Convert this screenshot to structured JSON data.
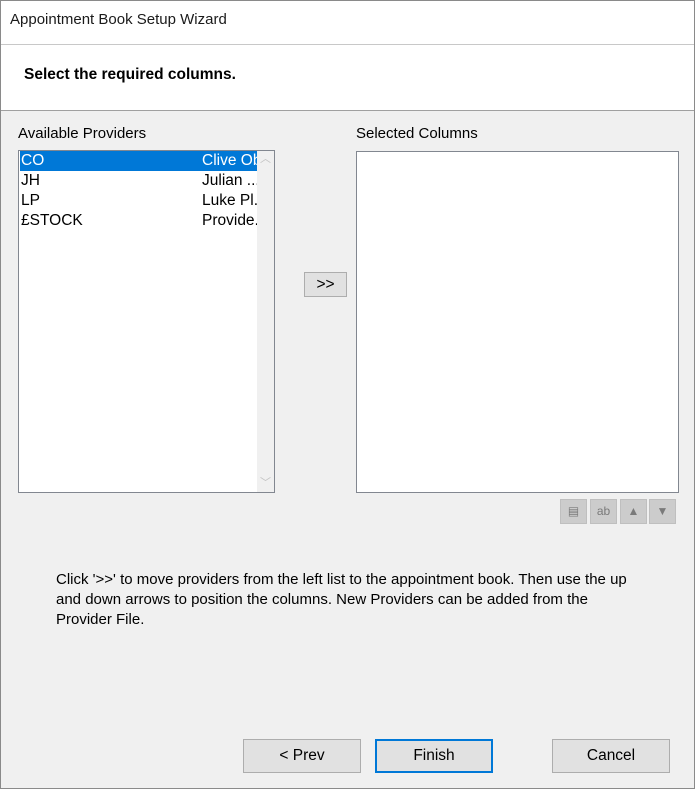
{
  "window": {
    "title": "Appointment Book Setup Wizard"
  },
  "header": {
    "heading": "Select the required columns."
  },
  "available": {
    "label": "Available Providers",
    "items": [
      {
        "code": "CO",
        "name": "Clive Obi",
        "selected": true
      },
      {
        "code": "JH",
        "name": "Julian ..."
      },
      {
        "code": "LP",
        "name": "Luke Pl..."
      },
      {
        "code": "£STOCK",
        "name": "Provide..."
      }
    ]
  },
  "selected": {
    "label": "Selected Columns"
  },
  "move_button": {
    "label": ">>"
  },
  "column_tools": [
    {
      "name": "properties-icon",
      "glyph": "▤"
    },
    {
      "name": "rename-icon",
      "glyph": "ab"
    },
    {
      "name": "arrow-up-icon",
      "glyph": "🡅"
    },
    {
      "name": "arrow-down-icon",
      "glyph": "🡇"
    }
  ],
  "help_text": "Click '>>' to move providers from the left list to the appointment book. Then use the up and down arrows to position the columns. New Providers can be added from the Provider File.",
  "footer": {
    "prev_label": "< Prev",
    "finish_label": "Finish",
    "cancel_label": "Cancel"
  },
  "colors": {
    "selection": "#0078d7",
    "dialog_bg": "#f0f0f0",
    "primary_border": "#0078d7"
  }
}
